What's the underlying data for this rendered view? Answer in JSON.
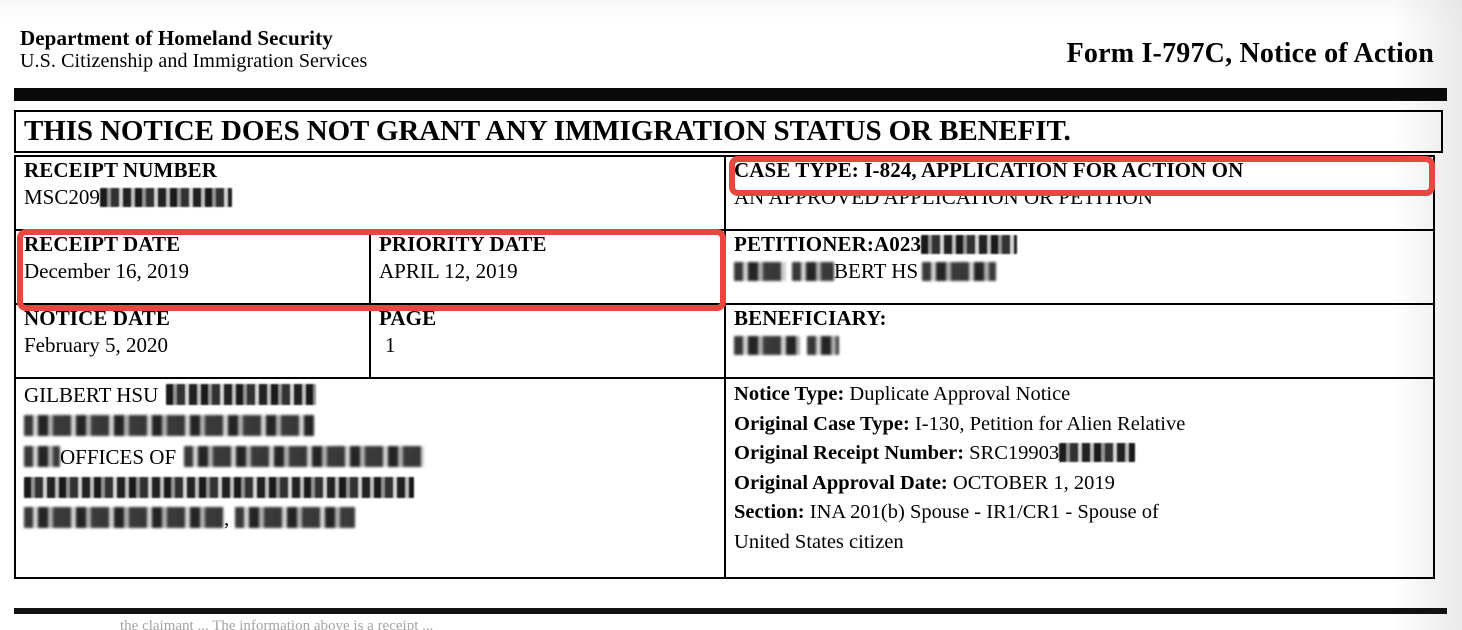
{
  "document": {
    "type": "uscis-notice-of-action",
    "header": {
      "agency_line1": "Department of Homeland Security",
      "agency_line2": "U.S. Citizenship and Immigration Services",
      "form_title": "Form I-797C, Notice of Action"
    },
    "banner": {
      "text": "THIS NOTICE DOES NOT GRANT ANY IMMIGRATION STATUS OR BENEFIT."
    },
    "fields": {
      "receipt_number": {
        "label": "RECEIPT NUMBER",
        "value_visible": "MSC209",
        "value_redacted": true
      },
      "case_type": {
        "label": "CASE TYPE:",
        "line1": "CASE TYPE: I-824, APPLICATION FOR ACTION ON",
        "line2": "AN APPROVED APPLICATION OR PETITION"
      },
      "receipt_date": {
        "label": "RECEIPT DATE",
        "value": "December 16, 2019"
      },
      "priority_date": {
        "label": "PRIORITY DATE",
        "value": "APRIL 12, 2019"
      },
      "petitioner": {
        "label": "PETITIONER:",
        "a_number_visible": "PETITIONER:A023",
        "name_visible": "BERT HS",
        "redacted": true
      },
      "notice_date": {
        "label": "NOTICE DATE",
        "value": "February 5, 2020"
      },
      "page": {
        "label": "PAGE",
        "value": "1"
      },
      "beneficiary": {
        "label": "BENEFICIARY:",
        "value_redacted": true
      }
    },
    "mailing_address": {
      "line1_visible": "GILBERT HSU",
      "line2_visible": "",
      "line3_visible": "OFFICES OF",
      "line4_visible": "",
      "line5_visible": ",",
      "redacted": true
    },
    "notice_details": [
      {
        "label": "Notice Type:",
        "value": " Duplicate Approval Notice"
      },
      {
        "label": "Original Case Type:",
        "value": " I-130, Petition for Alien Relative"
      },
      {
        "label": "Original Receipt Number:",
        "value": " SRC19903",
        "redacted": true
      },
      {
        "label": "Original Approval Date:",
        "value": " OCTOBER 1, 2019"
      },
      {
        "label": "Section:",
        "value": " INA 201(b) Spouse - IR1/CR1 - Spouse of"
      },
      {
        "label": "",
        "value": "United States citizen"
      }
    ],
    "annotations": {
      "color": "#e8473f",
      "boxes": [
        {
          "name": "case-type-highlight",
          "target": "CASE TYPE: I-824, APPLICATION FOR ACTION ON"
        },
        {
          "name": "dates-highlight",
          "target": "RECEIPT DATE / PRIORITY DATE"
        }
      ]
    },
    "footer_sliver": "the claimant ... The information above is a receipt ..."
  }
}
